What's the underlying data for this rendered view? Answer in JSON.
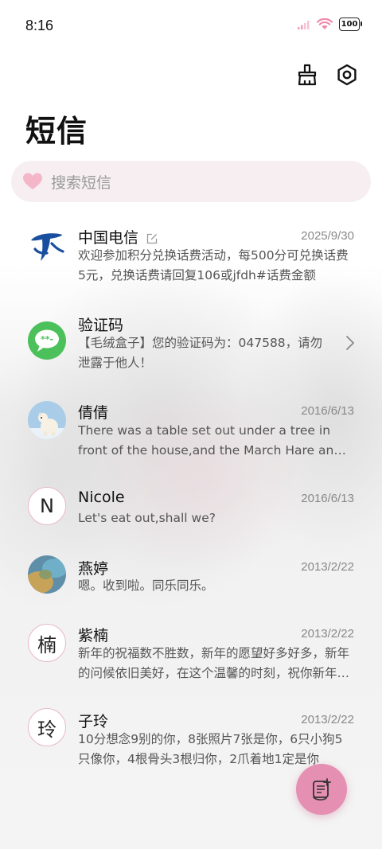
{
  "status_bar": {
    "time": "8:16",
    "battery": "100"
  },
  "header": {
    "title": "短信",
    "clean_icon": "broom-icon",
    "settings_icon": "gear-icon"
  },
  "search": {
    "placeholder": "搜索短信",
    "icon": "heart-icon"
  },
  "messages": [
    {
      "name": "中国电信",
      "date": "2025/9/30",
      "preview": "欢迎参加积分兑换话费活动，每500分可兑换话费5元，兑换话费请回复106或jfdh#话费金额"
    },
    {
      "name": "验证码",
      "date": "",
      "preview": "【毛绒盒子】您的验证码为：047588，请勿泄露于他人！"
    },
    {
      "name": "倩倩",
      "date": "2016/6/13",
      "preview": "There was a table set out under a tree in front of the house,and the March Hare and the Hatter"
    },
    {
      "name": "Nicole",
      "date": "2016/6/13",
      "preview": "Let's eat out,shall we?",
      "avatar_letter": "N"
    },
    {
      "name": "燕婷",
      "date": "2013/2/22",
      "preview": "嗯。收到啦。同乐同乐。"
    },
    {
      "name": "紫楠",
      "date": "2013/2/22",
      "preview": "新年的祝福数不胜数，新年的愿望好多好多，新年的问候依旧美好，在这个温馨的时刻，祝你新年快乐",
      "avatar_letter": "楠"
    },
    {
      "name": "子玲",
      "date": "2013/2/22",
      "preview": "10分想念9别的你，8张照片7张是你，6只小狗5只像你，4根骨头3根归你，2爪着地1定是你",
      "avatar_letter": "玲"
    }
  ],
  "fab": {
    "icon": "new-message-icon"
  },
  "colors": {
    "accent": "#e58fb2",
    "search_bg": "#f6eef0",
    "telecom_blue": "#1a4fa0",
    "verify_green": "#4cc05a"
  }
}
